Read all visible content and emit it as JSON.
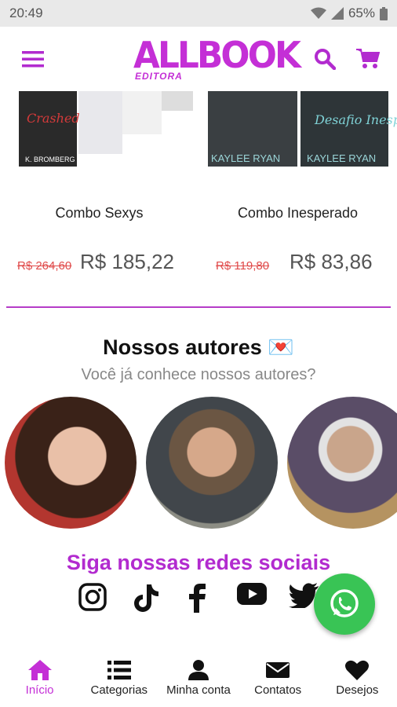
{
  "status": {
    "time": "20:49",
    "battery": "65%"
  },
  "header": {
    "logo_text": "ALLBOOK",
    "logo_sub": "EDITORA"
  },
  "products": [
    {
      "name": "Combo Sexys",
      "old_price": "R$ 264,60",
      "price": "R$  185,22",
      "cover_author": "K. BROMBERG",
      "cover_title": "Crashed"
    },
    {
      "name": "Combo Inesperado",
      "old_price": "R$ 119,80",
      "price": "R$  83,86",
      "cover_author": "KAYLEE RYAN",
      "cover_title": "Desafio Inesperado"
    }
  ],
  "authors_section": {
    "title": "Nossos autores 💌",
    "subtitle": "Você já conhece nossos autores?"
  },
  "social": {
    "title": "Siga nossas redes sociais",
    "icons": [
      "instagram-icon",
      "tiktok-icon",
      "facebook-icon",
      "youtube-icon",
      "twitter-icon"
    ]
  },
  "nav": [
    {
      "label": "Início",
      "icon": "home-icon",
      "active": true
    },
    {
      "label": "Categorias",
      "icon": "list-icon"
    },
    {
      "label": "Minha conta",
      "icon": "user-icon"
    },
    {
      "label": "Contatos",
      "icon": "mail-icon"
    },
    {
      "label": "Desejos",
      "icon": "heart-icon"
    }
  ],
  "colors": {
    "accent": "#c42fd6",
    "whatsapp": "#39c455",
    "old_price": "#e04b4b"
  }
}
